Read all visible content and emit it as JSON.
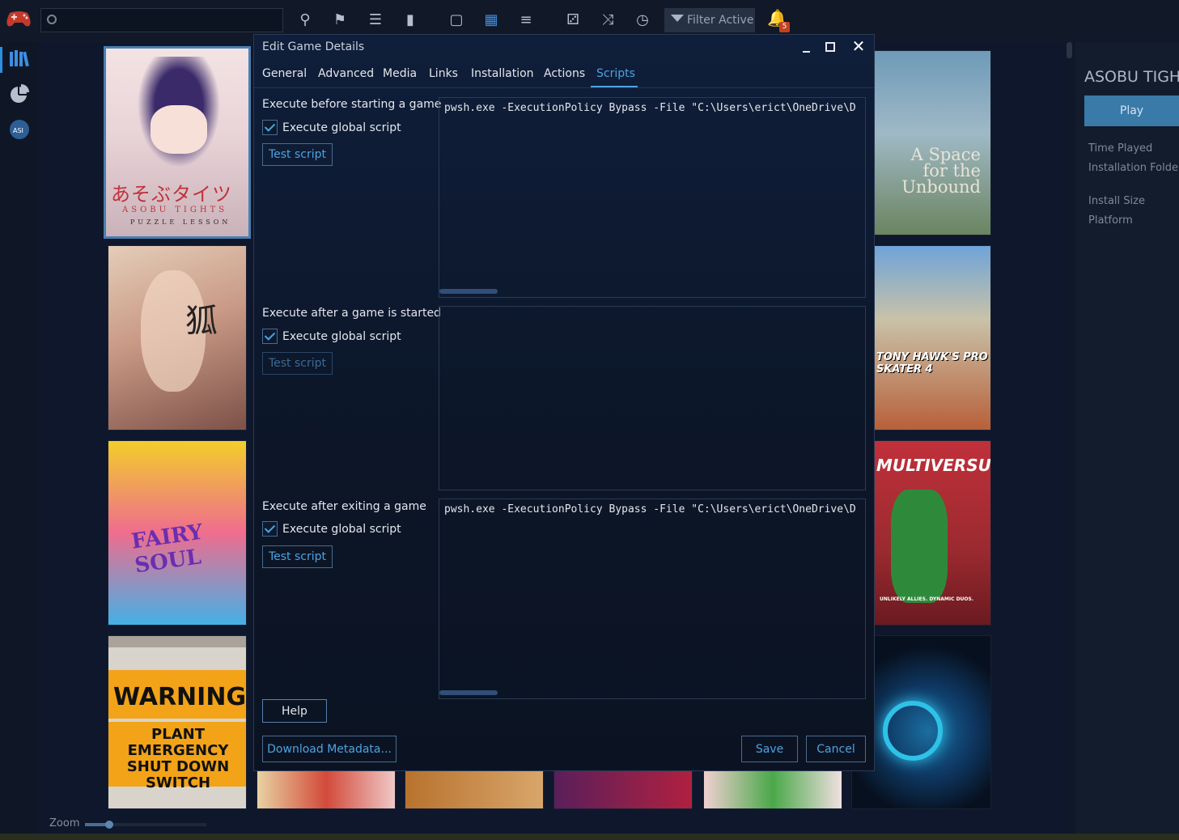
{
  "topbar": {
    "filter_label": "Filter Active",
    "notification_count": "5"
  },
  "library": {
    "covers": [
      {
        "title": "あそぶタイツ",
        "subtitle": "ASOBU TIGHTS",
        "tagline": "PUZZLE LESSON"
      },
      {
        "title": "A Space for the Unbound"
      },
      {
        "title": "TONY HAWK'S PRO SKATER 4"
      },
      {
        "title": "MULTIVERSUS",
        "tagline": "UNLIKELY ALLIES. DYNAMIC DUOS."
      },
      {
        "title": "FAIRY SOUL"
      },
      {
        "title": "WARNING",
        "subtitle": "PLANT EMERGENCY SHUT DOWN SWITCH"
      }
    ]
  },
  "zoom_label": "Zoom",
  "zoom_level": 0.17,
  "details": {
    "title": "ASOBU TIGHTS",
    "play_label": "Play",
    "time_played": "Time Played",
    "installation_folder": "Installation Folder",
    "install_size": "Install Size",
    "platform": "Platform"
  },
  "dialog": {
    "title": "Edit Game Details",
    "tabs": [
      "General",
      "Advanced",
      "Media",
      "Links",
      "Installation",
      "Actions",
      "Scripts"
    ],
    "active_tab": "Scripts",
    "sections": [
      {
        "label": "Execute before starting a game",
        "global_label": "Execute global script",
        "global_checked": true,
        "test_label": "Test script",
        "test_enabled": true,
        "script": "pwsh.exe -ExecutionPolicy Bypass -File \"C:\\Users\\erict\\OneDrive\\D"
      },
      {
        "label": "Execute after a game is started",
        "global_label": "Execute global script",
        "global_checked": true,
        "test_label": "Test script",
        "test_enabled": false,
        "script": ""
      },
      {
        "label": "Execute after exiting a game",
        "global_label": "Execute global script",
        "global_checked": true,
        "test_label": "Test script",
        "test_enabled": true,
        "script": "pwsh.exe -ExecutionPolicy Bypass -File \"C:\\Users\\erict\\OneDrive\\D"
      }
    ],
    "help_label": "Help",
    "download_metadata_label": "Download Metadata...",
    "save_label": "Save",
    "cancel_label": "Cancel"
  },
  "colors": {
    "accent": "#4ba3e3",
    "dialog_bg": "#0f1e3a",
    "play_button": "#3a7aa8",
    "badge": "#c3431f"
  }
}
